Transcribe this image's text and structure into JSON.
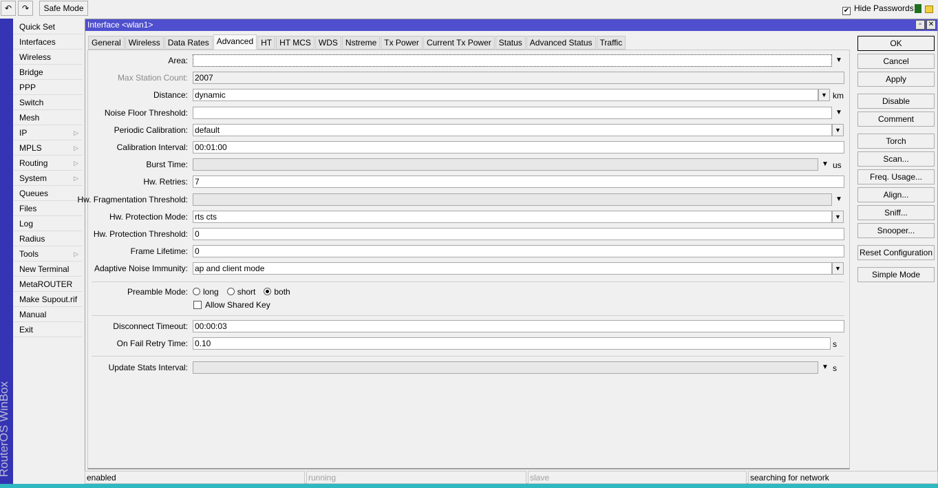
{
  "toolbar": {
    "undo_icon": "undo-icon",
    "redo_icon": "redo-icon",
    "safe_mode": "Safe Mode",
    "hide_passwords": "Hide Passwords",
    "hide_passwords_checked": true
  },
  "sidebar": {
    "brand": "RouterOS WinBox",
    "items": [
      {
        "label": "Quick Set"
      },
      {
        "label": "Interfaces"
      },
      {
        "label": "Wireless"
      },
      {
        "label": "Bridge"
      },
      {
        "label": "PPP"
      },
      {
        "label": "Switch"
      },
      {
        "label": "Mesh"
      },
      {
        "label": "IP",
        "submenu": true
      },
      {
        "label": "MPLS",
        "submenu": true
      },
      {
        "label": "Routing",
        "submenu": true
      },
      {
        "label": "System",
        "submenu": true
      },
      {
        "label": "Queues"
      },
      {
        "label": "Files"
      },
      {
        "label": "Log"
      },
      {
        "label": "Radius"
      },
      {
        "label": "Tools",
        "submenu": true
      },
      {
        "label": "New Terminal"
      },
      {
        "label": "MetaROUTER"
      },
      {
        "label": "Make Supout.rif"
      },
      {
        "label": "Manual"
      },
      {
        "label": "Exit"
      }
    ]
  },
  "window": {
    "title": "Interface <wlan1>",
    "tabs": [
      "General",
      "Wireless",
      "Data Rates",
      "Advanced",
      "HT",
      "HT MCS",
      "WDS",
      "Nstreme",
      "Tx Power",
      "Current Tx Power",
      "Status",
      "Advanced Status",
      "Traffic"
    ],
    "active_tab": "Advanced",
    "fields": [
      {
        "label": "Area:",
        "value": "",
        "kind": "dropdown-arrow",
        "focused": true
      },
      {
        "label": "Max Station Count:",
        "value": "2007",
        "kind": "text",
        "label_disabled": true
      },
      {
        "label": "Distance:",
        "value": "dynamic",
        "kind": "select",
        "unit": "km"
      },
      {
        "label": "Noise Floor Threshold:",
        "value": "",
        "kind": "dropdown-arrow"
      },
      {
        "label": "Periodic Calibration:",
        "value": "default",
        "kind": "select"
      },
      {
        "label": "Calibration Interval:",
        "value": "00:01:00",
        "kind": "text"
      },
      {
        "label": "Burst Time:",
        "value": "",
        "kind": "disabled-arrow",
        "unit": "us"
      },
      {
        "label": "Hw. Retries:",
        "value": "7",
        "kind": "text"
      },
      {
        "label": "Hw. Fragmentation Threshold:",
        "value": "",
        "kind": "disabled-arrow-full"
      },
      {
        "label": "Hw. Protection Mode:",
        "value": "rts cts",
        "kind": "select"
      },
      {
        "label": "Hw. Protection Threshold:",
        "value": "0",
        "kind": "text"
      },
      {
        "label": "Frame Lifetime:",
        "value": "0",
        "kind": "text"
      },
      {
        "label": "Adaptive Noise Immunity:",
        "value": "ap and client mode",
        "kind": "select"
      }
    ],
    "preamble": {
      "label": "Preamble Mode:",
      "options": [
        "long",
        "short",
        "both"
      ],
      "selected": "both"
    },
    "allow_shared_key": {
      "label": "Allow Shared Key",
      "checked": false
    },
    "fields2": [
      {
        "label": "Disconnect Timeout:",
        "value": "00:00:03",
        "kind": "text"
      },
      {
        "label": "On Fail Retry Time:",
        "value": "0.10",
        "kind": "text-unit",
        "unit": "s"
      }
    ],
    "fields3": [
      {
        "label": "Update Stats Interval:",
        "value": "",
        "kind": "disabled-arrow",
        "unit": "s"
      }
    ],
    "buttons": [
      "OK",
      "Cancel",
      "Apply",
      "Disable",
      "Comment",
      "Torch",
      "Scan...",
      "Freq. Usage...",
      "Align...",
      "Sniff...",
      "Snooper...",
      "Reset Configuration",
      "Simple Mode"
    ],
    "status": [
      "enabled",
      "running",
      "slave",
      "searching for network"
    ],
    "status_disabled": [
      false,
      true,
      true,
      false
    ]
  },
  "colors": {
    "title_bar": "#4f4fcf",
    "sidebar_strip": "#3434b4"
  }
}
